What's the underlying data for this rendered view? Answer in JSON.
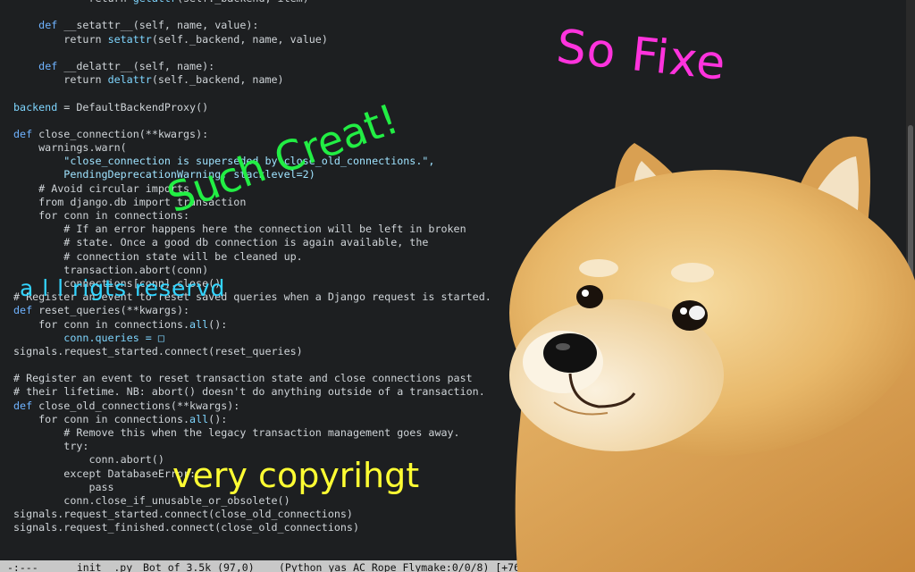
{
  "editor": {
    "code_lines": [
      [
        {
          "t": "            return ",
          "c": "#cfd4d8"
        },
        {
          "t": "getattr",
          "c": "#7fd6ff"
        },
        {
          "t": "(self._backend, item)",
          "c": "#cfd4d8"
        }
      ],
      [
        {
          "t": "",
          "c": "#cfd4d8"
        }
      ],
      [
        {
          "t": "    ",
          "c": "#cfd4d8"
        },
        {
          "t": "def",
          "c": "#6fb3ff"
        },
        {
          "t": " __setattr__(self, name, value):",
          "c": "#cfd4d8"
        }
      ],
      [
        {
          "t": "        return ",
          "c": "#cfd4d8"
        },
        {
          "t": "setattr",
          "c": "#7fd6ff"
        },
        {
          "t": "(self._backend, name, value)",
          "c": "#cfd4d8"
        }
      ],
      [
        {
          "t": "",
          "c": "#cfd4d8"
        }
      ],
      [
        {
          "t": "    ",
          "c": "#cfd4d8"
        },
        {
          "t": "def",
          "c": "#6fb3ff"
        },
        {
          "t": " __delattr__(self, name):",
          "c": "#cfd4d8"
        }
      ],
      [
        {
          "t": "        return ",
          "c": "#cfd4d8"
        },
        {
          "t": "delattr",
          "c": "#7fd6ff"
        },
        {
          "t": "(self._backend, name)",
          "c": "#cfd4d8"
        }
      ],
      [
        {
          "t": "",
          "c": "#cfd4d8"
        }
      ],
      [
        {
          "t": "backend",
          "c": "#7fd6ff"
        },
        {
          "t": " = DefaultBackendProxy()",
          "c": "#cfd4d8"
        }
      ],
      [
        {
          "t": "",
          "c": "#cfd4d8"
        }
      ],
      [
        {
          "t": "def",
          "c": "#6fb3ff"
        },
        {
          "t": " close_connection(**kwargs):",
          "c": "#cfd4d8"
        }
      ],
      [
        {
          "t": "    warnings.warn(",
          "c": "#cfd4d8"
        }
      ],
      [
        {
          "t": "        \"close_connection is superseded by close_old_connections.\",",
          "c": "#9fe3ff"
        }
      ],
      [
        {
          "t": "        PendingDeprecationWarning, stacklevel=2)",
          "c": "#9fe3ff"
        }
      ],
      [
        {
          "t": "    # Avoid circular imports",
          "c": "#cfd4d8"
        }
      ],
      [
        {
          "t": "    from django.db import transaction",
          "c": "#cfd4d8"
        }
      ],
      [
        {
          "t": "    for conn in connections:",
          "c": "#cfd4d8"
        }
      ],
      [
        {
          "t": "        # If an error happens here the connection will be left in broken",
          "c": "#cfd4d8"
        }
      ],
      [
        {
          "t": "        # state. Once a good db connection is again available, the",
          "c": "#cfd4d8"
        }
      ],
      [
        {
          "t": "        # connection state will be cleaned up.",
          "c": "#cfd4d8"
        }
      ],
      [
        {
          "t": "        transaction.abort(conn)",
          "c": "#cfd4d8"
        }
      ],
      [
        {
          "t": "        connections[conn].close()",
          "c": "#cfd4d8"
        }
      ],
      [
        {
          "t": "# Register an event to reset saved queries when a Django request is started.",
          "c": "#cfd4d8"
        }
      ],
      [
        {
          "t": "def",
          "c": "#6fb3ff"
        },
        {
          "t": " reset_queries(**kwargs):",
          "c": "#cfd4d8"
        }
      ],
      [
        {
          "t": "    for conn in connections.",
          "c": "#cfd4d8"
        },
        {
          "t": "all",
          "c": "#7fd6ff"
        },
        {
          "t": "():",
          "c": "#cfd4d8"
        }
      ],
      [
        {
          "t": "        conn.queries = □",
          "c": "#7fd6ff"
        }
      ],
      [
        {
          "t": "signals.request_started.connect(reset_queries)",
          "c": "#cfd4d8"
        }
      ],
      [
        {
          "t": "",
          "c": "#cfd4d8"
        }
      ],
      [
        {
          "t": "# Register an event to reset transaction state and close connections past",
          "c": "#cfd4d8"
        }
      ],
      [
        {
          "t": "# their lifetime. NB: abort() doesn't do anything outside of a transaction.",
          "c": "#cfd4d8"
        }
      ],
      [
        {
          "t": "def",
          "c": "#6fb3ff"
        },
        {
          "t": " close_old_connections(**kwargs):",
          "c": "#cfd4d8"
        }
      ],
      [
        {
          "t": "    for conn in connections.",
          "c": "#cfd4d8"
        },
        {
          "t": "all",
          "c": "#7fd6ff"
        },
        {
          "t": "():",
          "c": "#cfd4d8"
        }
      ],
      [
        {
          "t": "        # Remove this when the legacy transaction management goes away.",
          "c": "#cfd4d8"
        }
      ],
      [
        {
          "t": "        try:",
          "c": "#cfd4d8"
        }
      ],
      [
        {
          "t": "            conn.abort()",
          "c": "#cfd4d8"
        }
      ],
      [
        {
          "t": "        except DatabaseError:",
          "c": "#cfd4d8"
        }
      ],
      [
        {
          "t": "            pass",
          "c": "#cfd4d8"
        }
      ],
      [
        {
          "t": "        conn.close_if_unusable_or_obsolete()",
          "c": "#cfd4d8"
        }
      ],
      [
        {
          "t": "signals.request_started.connect(close_old_connections)",
          "c": "#cfd4d8"
        }
      ],
      [
        {
          "t": "signals.request_finished.connect(close_old_connections)",
          "c": "#cfd4d8"
        }
      ]
    ]
  },
  "modeline": {
    "status": "-:---",
    "filename": "__init__.py",
    "position": "Bot of 3.5k (97,0)",
    "modes": "(Python yas AC Rope Flymake:0/0/8) [+76%]"
  },
  "captions": {
    "so_fixe": "So Fixe",
    "such_creat": "Such Creat!",
    "rights": "a l l  rigts reservd",
    "copyright": "very copyrihgt"
  },
  "colors": {
    "background": "#1d1f21",
    "code_text": "#cfd4d8",
    "keyword": "#6fb3ff",
    "builtin": "#7fd6ff",
    "string": "#9fe3ff",
    "caption_pink": "#ff33dd",
    "caption_green": "#22ee44",
    "caption_cyan": "#33d4ff",
    "caption_yellow": "#ffff33"
  },
  "images": {
    "doge": "shiba-inu-dog-photo"
  }
}
